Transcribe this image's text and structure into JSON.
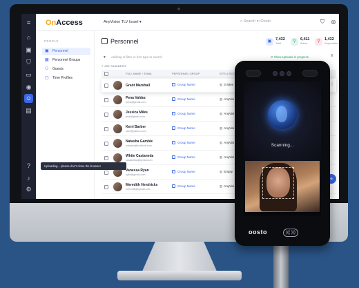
{
  "app": {
    "name_prefix": "On",
    "name_suffix": "Access",
    "org_selector": "AnyVision TLV Israel ▾"
  },
  "header": {
    "search_placeholder": "Search in Oosto",
    "icons": [
      "shield-icon",
      "user-circle-icon"
    ]
  },
  "rail_icons": [
    "menu-icon",
    "home-icon",
    "dashboard-icon",
    "shield-icon",
    "devices-icon",
    "location-icon",
    "people-icon",
    "document-icon",
    "help-icon",
    "notification-icon",
    "settings-icon"
  ],
  "sidenav": {
    "section": "PEOPLE",
    "items": [
      {
        "label": "Personnel",
        "icon": "person-icon",
        "active": true
      },
      {
        "label": "Personnel Groups",
        "icon": "group-icon",
        "active": false
      },
      {
        "label": "Guests",
        "icon": "guests-icon",
        "active": false
      },
      {
        "label": "Time Profiles",
        "icon": "calendar-icon",
        "active": false
      }
    ]
  },
  "page": {
    "title": "Personnel",
    "stats": [
      {
        "value": "7,432",
        "label": "Total",
        "color": "#3a66e6"
      },
      {
        "value": "6,411",
        "label": "Active",
        "color": "#2aa36a"
      },
      {
        "value": "1,432",
        "label": "Suspended",
        "color": "#e0455a"
      }
    ],
    "filter_placeholder": "Add tag to filter or free type to search",
    "upload_link": "Show Uploads in progress",
    "count_label": "7,432 NUMBERS",
    "columns": [
      "FULL NAME ↑ EMAIL",
      "PERSONNEL GROUP",
      "SITE & SCO..."
    ]
  },
  "rows": [
    {
      "name": "Grant Marshall",
      "email": "",
      "group": "Group Name",
      "site": "3 Sites",
      "highlight": true
    },
    {
      "name": "Pena Valdez",
      "email": "pena@gmail.com",
      "group": "Group Name",
      "site": "AnyVisi",
      "highlight": false
    },
    {
      "name": "Jessica Miles",
      "email": "jess@gmail.com",
      "group": "Group Name",
      "site": "AnyVisi",
      "highlight": false
    },
    {
      "name": "Kerri Barber",
      "email": "kerri@yahoo.com",
      "group": "Group Name",
      "site": "AnyVisi",
      "highlight": false
    },
    {
      "name": "Natasha Gamble",
      "email": "natasha@outlook.com",
      "group": "Group Name",
      "site": "AnyVisi",
      "highlight": false
    },
    {
      "name": "White Castaneda",
      "email": "castaneda@gmail.com",
      "group": "Group Name",
      "site": "AnyVisi",
      "highlight": false
    },
    {
      "name": "Vanessa Ryan",
      "email": "ryan@gmail.com",
      "group": "Group Name",
      "site": "Empty",
      "highlight": false
    },
    {
      "name": "Meredith Hendricks",
      "email": "meredith@gmail.com",
      "group": "Group Name",
      "site": "AnyVisi",
      "highlight": false
    }
  ],
  "toast": "Uploading... please don't close the browser",
  "device": {
    "status": "Scanning...",
    "brand": "oosto",
    "nfc_label": "((( ))) "
  },
  "colors": {
    "accent": "#3a66e6",
    "rail": "#1f2230",
    "background": "#2a5486"
  }
}
